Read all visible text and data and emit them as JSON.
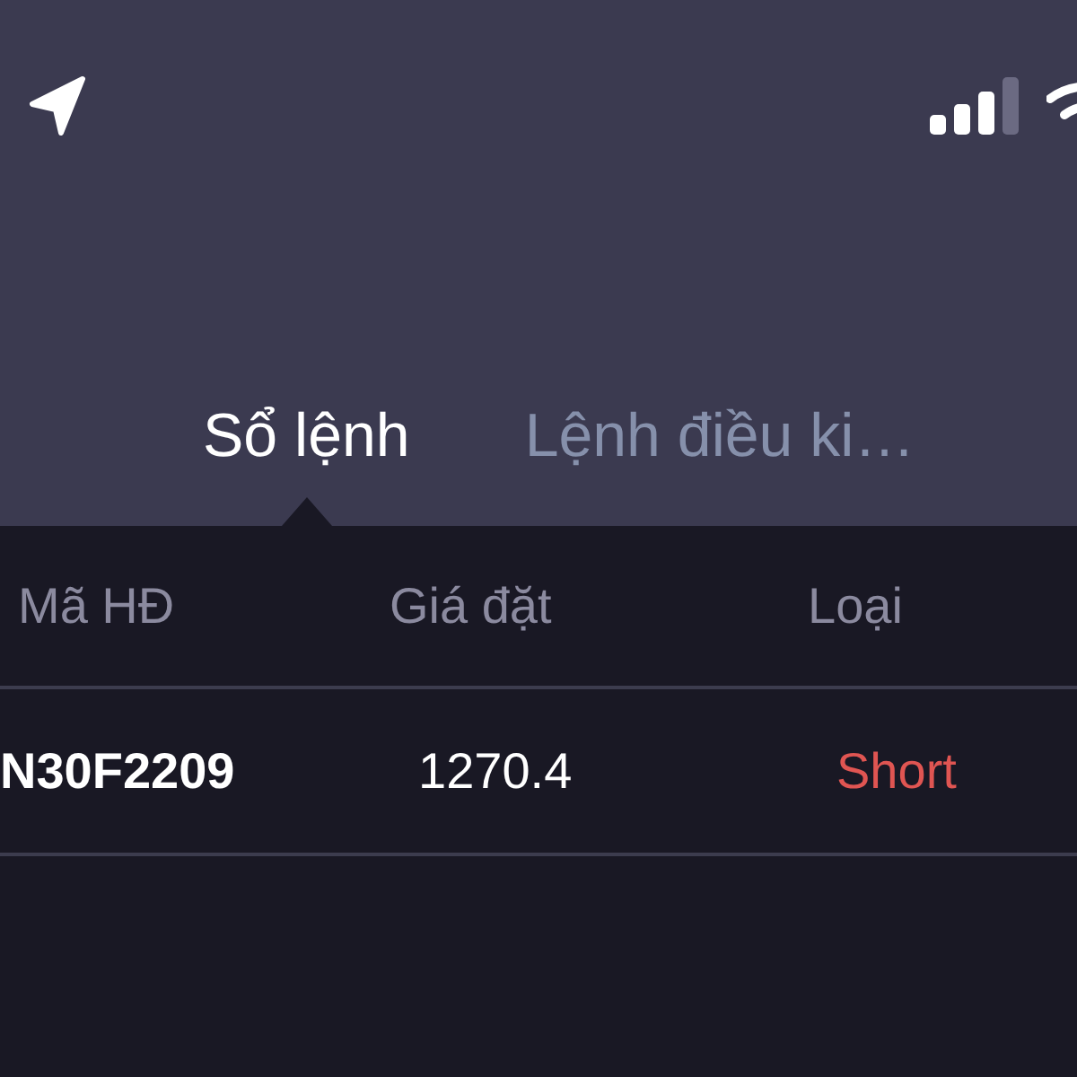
{
  "tabs": [
    {
      "label": "Sổ lệnh",
      "selected": true
    },
    {
      "label": "Lệnh điều ki…",
      "selected": false
    }
  ],
  "table": {
    "columns": [
      "Mã HĐ",
      "Giá đặt",
      "Loại"
    ],
    "rows": [
      {
        "code": "N30F2209",
        "price": "1270.4",
        "type": {
          "label": "Short",
          "kind": "short"
        }
      }
    ]
  }
}
